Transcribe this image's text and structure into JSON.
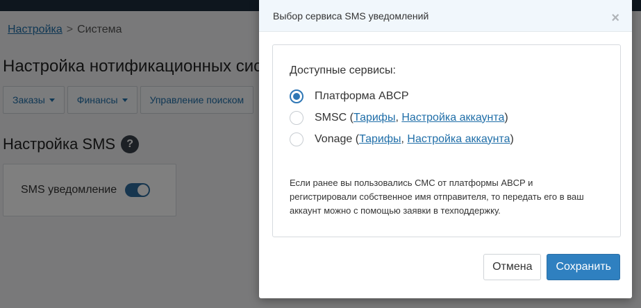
{
  "breadcrumb": {
    "root": "Настройка",
    "separator": ">",
    "current": "Система"
  },
  "page": {
    "title": "Настройка нотификационных систем",
    "tabs": [
      {
        "label": "Заказы",
        "dropdown": true
      },
      {
        "label": "Финансы",
        "dropdown": true
      },
      {
        "label": "Управление поиском",
        "dropdown": false
      }
    ],
    "section_title": "Настройка SMS",
    "sms_toggle": {
      "label": "SMS уведомление",
      "enabled": true
    }
  },
  "modal": {
    "title": "Выбор сервиса SMS уведомлений",
    "close_symbol": "×",
    "available_label": "Доступные сервисы:",
    "services": [
      {
        "name": "Платформа ABCP",
        "selected": true
      },
      {
        "name": "SMSC",
        "selected": false,
        "link_tariffs": "Тарифы",
        "link_account": "Настройка аккаунта"
      },
      {
        "name": "Vonage",
        "selected": false,
        "link_tariffs": "Тарифы",
        "link_account": "Настройка аккаунта"
      }
    ],
    "note": "Если ранее вы пользовались СМС от платформы ABCP и регистрировали собственное имя отправителя, то передать его в ваш аккаунт можно с помощью заявки в техподдержку.",
    "cancel_label": "Отмена",
    "save_label": "Сохранить"
  },
  "colors": {
    "accent": "#2f80c0",
    "link": "#1f6ea8",
    "topbar": "#1c2c3c"
  }
}
